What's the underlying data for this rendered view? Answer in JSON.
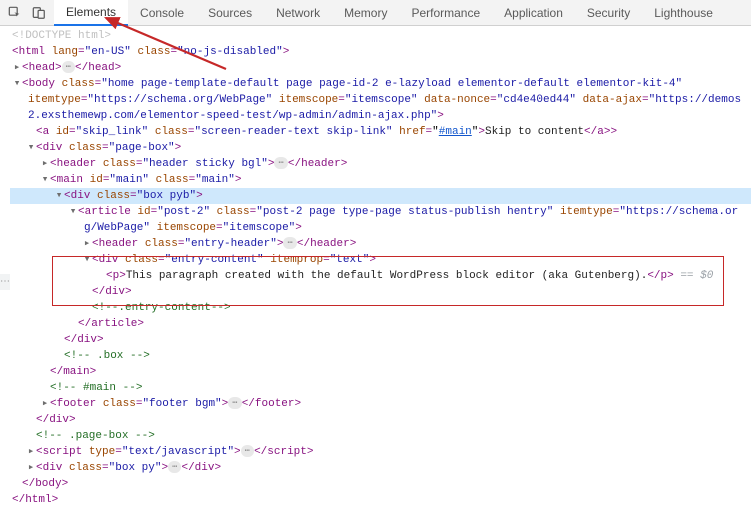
{
  "tabs": {
    "elements": "Elements",
    "console": "Console",
    "sources": "Sources",
    "network": "Network",
    "memory": "Memory",
    "performance": "Performance",
    "application": "Application",
    "security": "Security",
    "lighthouse": "Lighthouse"
  },
  "tree": {
    "doctype": "<!DOCTYPE html>",
    "html_open_pre": "<html ",
    "html_lang_name": "lang",
    "html_lang_val": "\"en-US\"",
    "html_class_name": "class",
    "html_class_val": "\"no-js-disabled\"",
    "head_open": "<head>",
    "head_close": "</head>",
    "body_open": "<body ",
    "body_class": "\"home page-template-default page page-id-2 e-lazyload elementor-default elementor-kit-4\"",
    "body_itemtype": "\"https://schema.org/WebPage\"",
    "body_itemscope": "\"itemscope\"",
    "body_datanonce": "\"cd4e40ed44\"",
    "body_dataajax": "\"https://demos2.exsthemewp.com/elementor-speed-test/wp-admin/admin-ajax.php\"",
    "a_id": "\"skip_link\"",
    "a_class": "\"screen-reader-text skip-link\"",
    "a_href": "#main",
    "a_text": "Skip to content",
    "div_pagebox": "\"page-box\"",
    "header_class": "\"header sticky bgl\"",
    "main_id": "\"main\"",
    "main_class": "\"main\"",
    "div_boxpyb": "\"box pyb\"",
    "article_id": "\"post-2\"",
    "article_class": "\"post-2 page type-page status-publish hentry\"",
    "article_itemtype": "\"https://schema.org/WebPage\"",
    "article_itemscope": "\"itemscope\"",
    "hdr_class": "\"entry-header\"",
    "entry_content_class": "\"entry-content\"",
    "entry_content_itemprop": "\"text\"",
    "p_text": "This paragraph created with the default WordPress block editor (aka Gutenberg).",
    "eq_marker": "== $0",
    "comment_entry": "<!--.entry-content-->",
    "comment_box": "<!-- .box -->",
    "comment_main": "<!-- #main -->",
    "footer_class": "\"footer bgm\"",
    "comment_pagebox": "<!-- .page-box -->",
    "script_type": "\"text/javascript\"",
    "div_boxpy": "\"box py\"",
    "attr": {
      "class": "class",
      "id": "id",
      "itemtype": "itemtype",
      "itemscope": "itemscope",
      "datanonce": "data-nonce",
      "dataajax": "data-ajax",
      "href": "href",
      "itemprop": "itemprop",
      "type": "type"
    },
    "tags": {
      "html_close": "</html>",
      "body_close": "</body>",
      "a_open": "<a ",
      "a_close": "</a>",
      "div_open": "<div ",
      "div_close": "</div>",
      "header_open": "<header ",
      "header_close": "</header>",
      "main_open": "<main ",
      "main_close": "</main>",
      "article_open": "<article ",
      "article_close": "</article>",
      "p_open": "<p>",
      "p_close": "</p>",
      "footer_open": "<footer ",
      "footer_close": "</footer>",
      "script_open": "<script ",
      "script_close": "</script>"
    }
  }
}
